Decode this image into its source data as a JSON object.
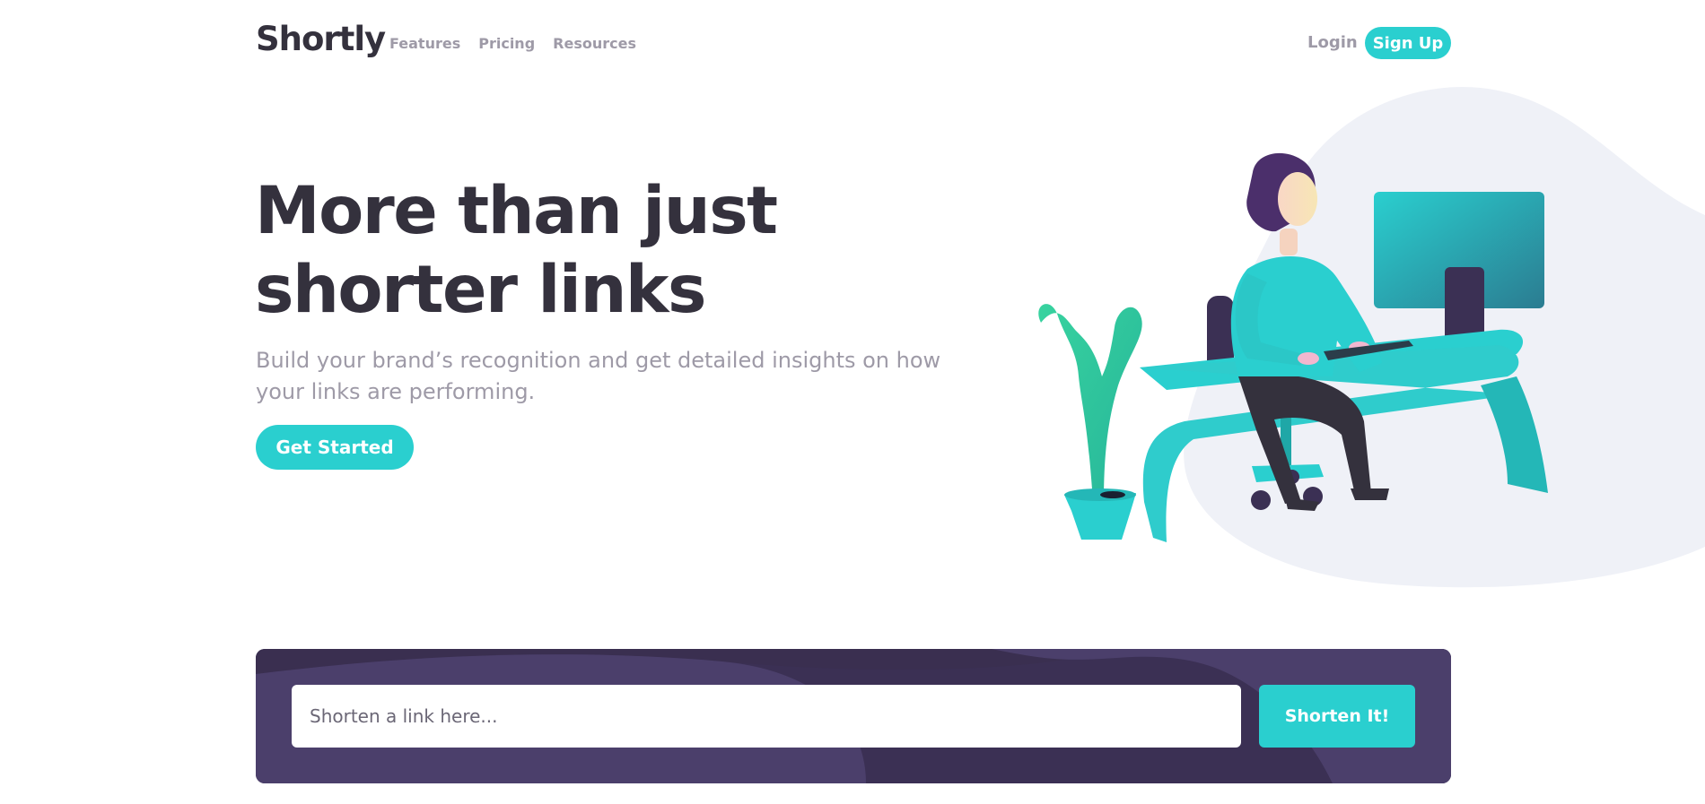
{
  "brand": {
    "name": "Shortly"
  },
  "nav": {
    "links": [
      "Features",
      "Pricing",
      "Resources"
    ],
    "login_label": "Login",
    "signup_label": "Sign Up"
  },
  "hero": {
    "title_line1": "More than just",
    "title_line2": "shorter links",
    "subtitle": "Build your brand’s recognition and get detailed insights on how your links are performing.",
    "cta_label": "Get Started"
  },
  "shorten": {
    "placeholder": "Shorten a link here...",
    "button_label": "Shorten It!"
  },
  "colors": {
    "accent": "#2acfcf",
    "dark_violet": "#3b3054",
    "very_dark_text": "#34313d",
    "gray_text": "#9e9aa7",
    "blob": "#eff1f7"
  },
  "icons": {
    "illustration": "person-working-at-desk-illustration"
  }
}
